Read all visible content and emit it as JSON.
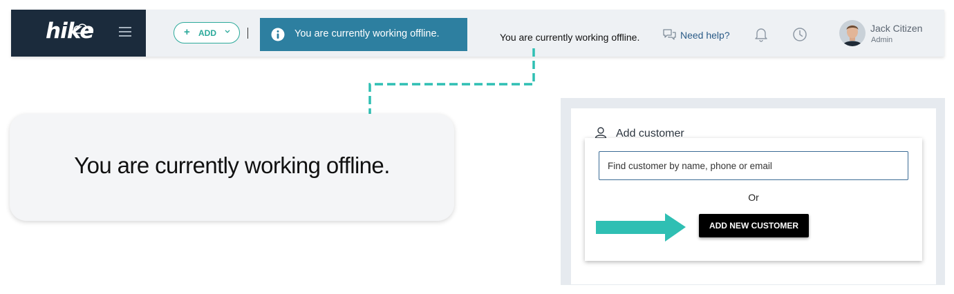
{
  "brand": {
    "logo_text": "hike"
  },
  "header": {
    "add_button_label": "ADD",
    "offline_banner_text": "You are currently working offline.",
    "status_text": "You are currently working offline.",
    "help_label": "Need help?",
    "user": {
      "name": "Jack Citizen",
      "role": "Admin"
    }
  },
  "callout": {
    "text": "You are currently working offline."
  },
  "add_customer": {
    "title": "Add customer",
    "search_placeholder": "Find customer by name, phone or email",
    "or_label": "Or",
    "add_new_label": "ADD NEW CUSTOMER"
  },
  "colors": {
    "header_bg": "#eef1f4",
    "logo_bg": "#1b2b3c",
    "banner_bg": "#2d7fa0",
    "accent_teal": "#2fbfb3",
    "link_blue": "#2a5b87"
  },
  "icons": [
    "menu-icon",
    "plus-icon",
    "chevron-down-icon",
    "info-icon",
    "chat-icon",
    "bell-icon",
    "clock-icon",
    "user-icon",
    "arrow-right-icon"
  ]
}
